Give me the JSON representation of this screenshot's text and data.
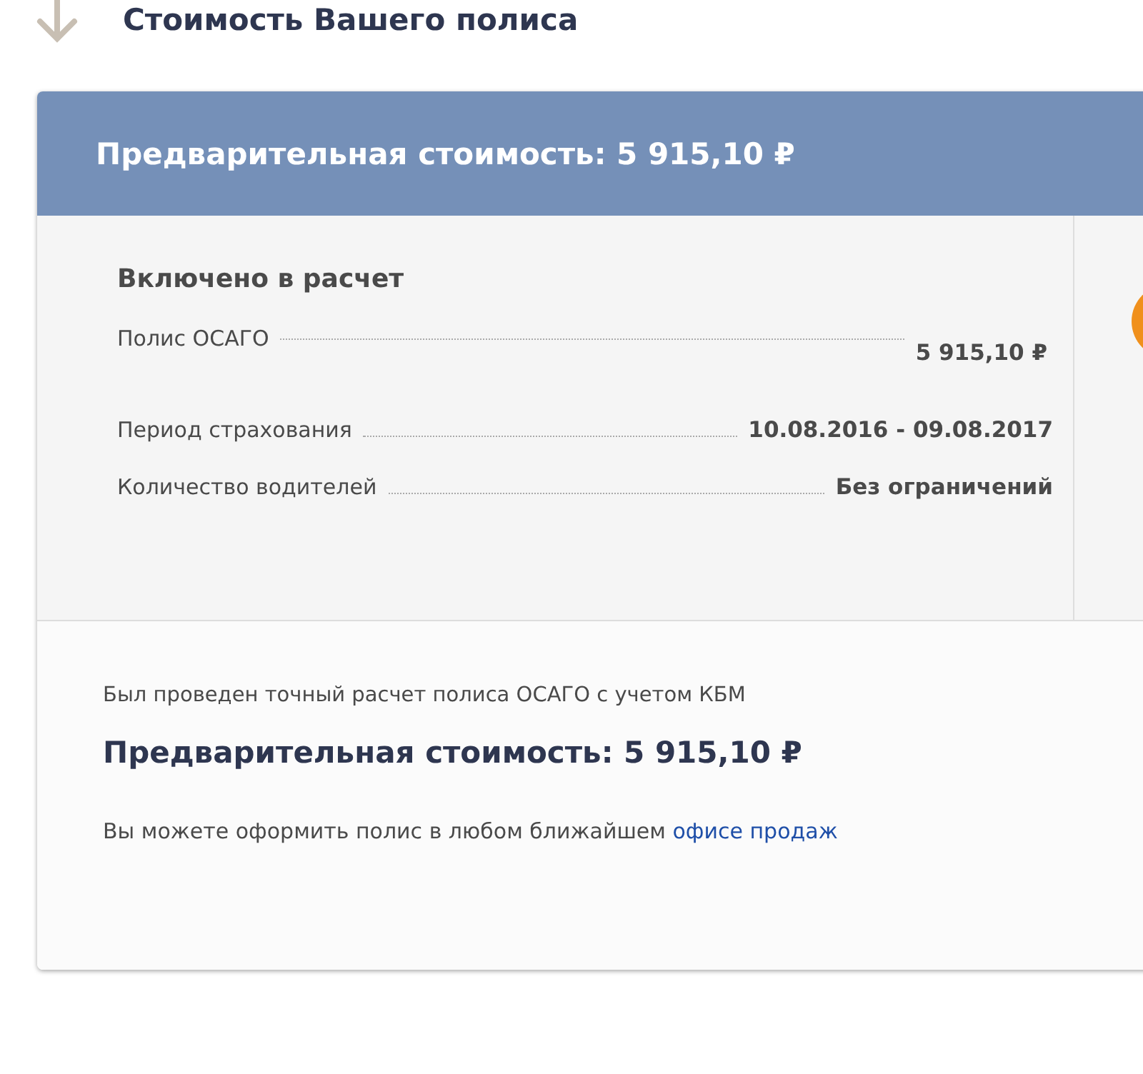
{
  "heading": "Стоимость Вашего полиса",
  "card": {
    "header": "Предварительная стоимость: 5 915,10 ₽",
    "section_title": "Включено в расчет",
    "rows": [
      {
        "label": "Полис ОСАГО",
        "value": "5 915,10 ₽"
      },
      {
        "label": "Период страхования",
        "value": "10.08.2016 - 09.08.2017"
      },
      {
        "label": "Количество водителей",
        "value": "Без ограничений"
      }
    ],
    "footer": {
      "note": "Был проведен точный расчет полиса ОСАГО с учетом КБМ",
      "total": "Предварительная стоимость: 5 915,10 ₽",
      "info": "Вы можете оформить полис в любом ближайшем",
      "link": "офисе продаж"
    }
  }
}
